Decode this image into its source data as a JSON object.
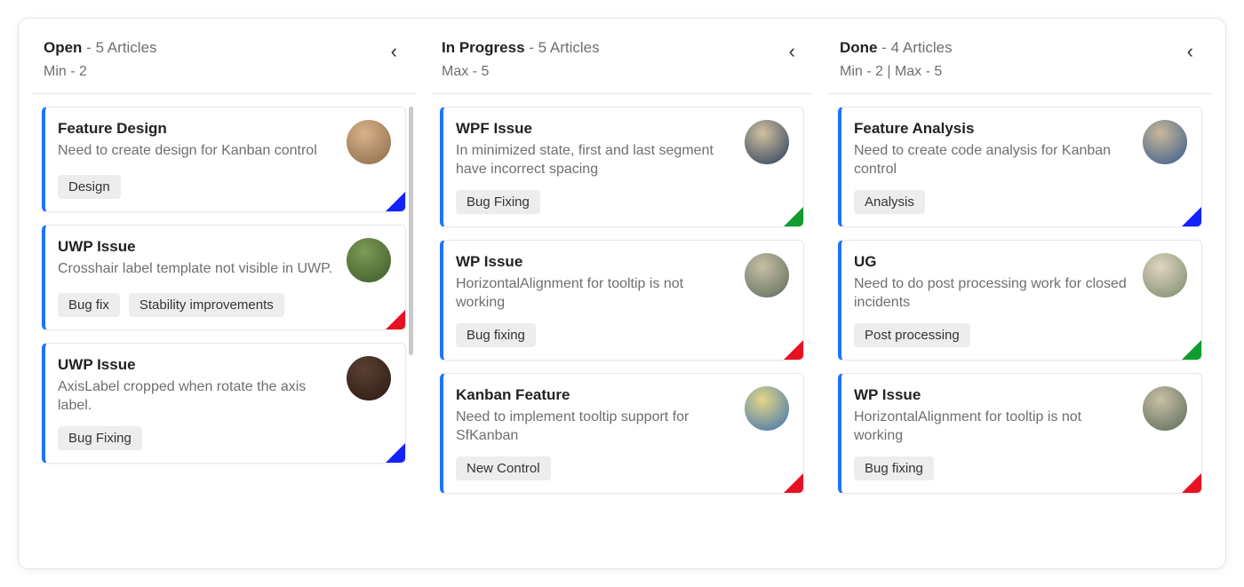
{
  "columns": [
    {
      "title": "Open",
      "count_label": "5 Articles",
      "sub": "Min - 2",
      "cards": [
        {
          "title": "Feature Design",
          "desc": "Need to create design for Kanban control",
          "tags": [
            "Design"
          ],
          "corner": "blue",
          "avatar_class": "av-a"
        },
        {
          "title": "UWP Issue",
          "desc": "Crosshair label template not visible in UWP.",
          "tags": [
            "Bug fix",
            "Stability improvements"
          ],
          "corner": "red",
          "avatar_class": "av-b"
        },
        {
          "title": "UWP Issue",
          "desc": "AxisLabel cropped when rotate the axis label.",
          "tags": [
            "Bug Fixing"
          ],
          "corner": "blue",
          "avatar_class": "av-c"
        }
      ],
      "show_scrollbar": true
    },
    {
      "title": "In Progress",
      "count_label": "5 Articles",
      "sub": "Max  - 5",
      "cards": [
        {
          "title": "WPF Issue",
          "desc": "In minimized state, first and last segment have incorrect spacing",
          "tags": [
            "Bug Fixing"
          ],
          "corner": "green",
          "avatar_class": "av-d"
        },
        {
          "title": "WP Issue",
          "desc": "HorizontalAlignment for tooltip is not working",
          "tags": [
            "Bug fixing"
          ],
          "corner": "red",
          "avatar_class": "av-e"
        },
        {
          "title": "Kanban Feature",
          "desc": "Need to implement tooltip support for SfKanban",
          "tags": [
            "New Control"
          ],
          "corner": "red",
          "avatar_class": "av-f"
        }
      ],
      "show_scrollbar": false
    },
    {
      "title": "Done",
      "count_label": "4 Articles",
      "sub": "Min - 2 | Max  - 5",
      "cards": [
        {
          "title": "Feature Analysis",
          "desc": "Need to create code analysis for Kanban control",
          "tags": [
            "Analysis"
          ],
          "corner": "blue",
          "avatar_class": "av-g"
        },
        {
          "title": "UG",
          "desc": "Need to do post processing work for closed incidents",
          "tags": [
            "Post processing"
          ],
          "corner": "green",
          "avatar_class": "av-h"
        },
        {
          "title": "WP Issue",
          "desc": "HorizontalAlignment for tooltip is not working",
          "tags": [
            "Bug fixing"
          ],
          "corner": "red",
          "avatar_class": "av-e"
        }
      ],
      "show_scrollbar": false
    }
  ]
}
